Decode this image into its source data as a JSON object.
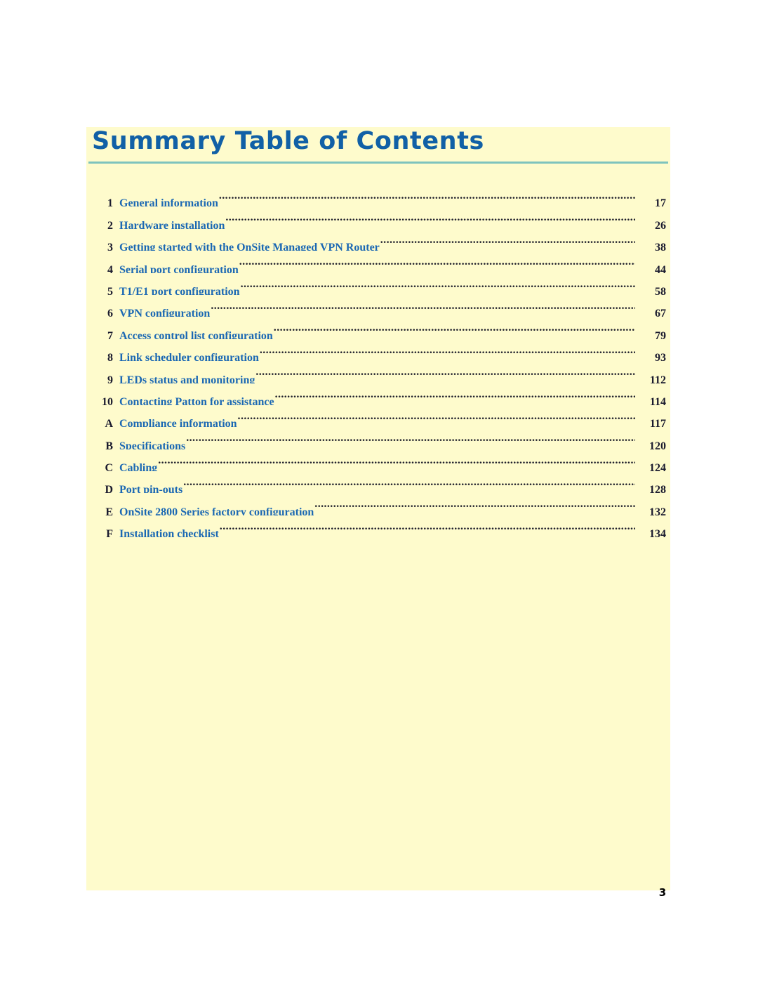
{
  "document": {
    "title": "Summary Table of Contents",
    "folio": "3"
  },
  "colors": {
    "panel_background": "#fefbcc",
    "title_blue": "#1160a6",
    "rule_teal": "#7ec3bd",
    "entry_blue": "#1b68b3",
    "number_dark": "#1a1a2e",
    "page_background": "#ffffff"
  },
  "toc": {
    "entries": [
      {
        "number": "1",
        "label": "General information",
        "page": "17"
      },
      {
        "number": "2",
        "label": "Hardware installation",
        "page": "26"
      },
      {
        "number": "3",
        "label": "Getting started with the OnSite Managed VPN Router",
        "page": "38"
      },
      {
        "number": "4",
        "label": "Serial port configuration",
        "page": "44"
      },
      {
        "number": "5",
        "label": "T1/E1 port configuration",
        "page": "58"
      },
      {
        "number": "6",
        "label": "VPN configuration",
        "page": "67"
      },
      {
        "number": "7",
        "label": "Access control list configuration",
        "page": "79"
      },
      {
        "number": "8",
        "label": "Link scheduler configuration",
        "page": "93"
      },
      {
        "number": "9",
        "label": "LEDs status and monitoring",
        "page": "112"
      },
      {
        "number": "10",
        "label": "Contacting Patton for assistance",
        "page": "114"
      },
      {
        "number": "A",
        "label": "Compliance information",
        "page": "117"
      },
      {
        "number": "B",
        "label": "Specifications",
        "page": "120"
      },
      {
        "number": "C",
        "label": "Cabling",
        "page": "124"
      },
      {
        "number": "D",
        "label": "Port pin-outs",
        "page": "128"
      },
      {
        "number": "E",
        "label": "OnSite 2800 Series factory configuration",
        "page": "132"
      },
      {
        "number": "F",
        "label": "Installation checklist",
        "page": "134"
      }
    ]
  }
}
